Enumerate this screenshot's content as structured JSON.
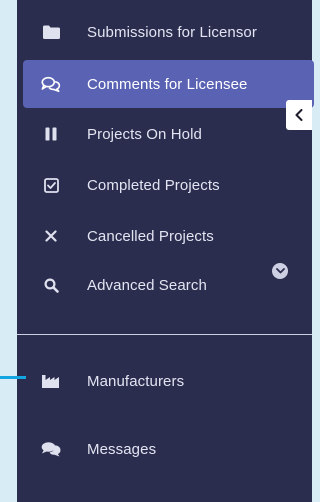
{
  "sidebar": {
    "items": [
      {
        "label": "Submissions for Licensor",
        "icon": "folder-icon"
      },
      {
        "label": "Comments for Licensee",
        "icon": "comments-icon",
        "active": true
      },
      {
        "label": "Projects On Hold",
        "icon": "pause-icon"
      },
      {
        "label": "Completed Projects",
        "icon": "check-square-icon"
      },
      {
        "label": "Cancelled Projects",
        "icon": "times-icon"
      },
      {
        "label": "Advanced Search",
        "icon": "search-icon"
      }
    ],
    "secondary_items": [
      {
        "label": "Manufacturers",
        "icon": "industry-icon"
      },
      {
        "label": "Messages",
        "icon": "messages-icon"
      }
    ]
  },
  "colors": {
    "sidebar_bg": "#2b2d4e",
    "active_bg": "#5a62b4",
    "page_bg": "#d8ecf6",
    "accent": "#13a6e0"
  }
}
